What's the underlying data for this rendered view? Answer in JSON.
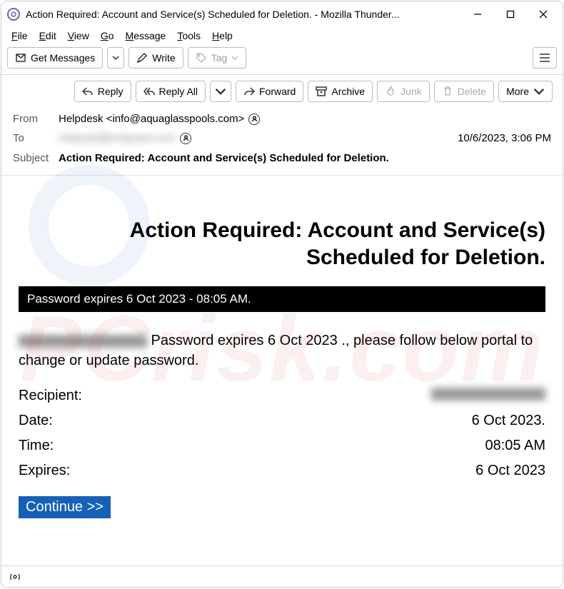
{
  "window": {
    "title": "Action Required: Account and Service(s) Scheduled for Deletion. - Mozilla Thunder..."
  },
  "menubar": {
    "file": "File",
    "edit": "Edit",
    "view": "View",
    "go": "Go",
    "message": "Message",
    "tools": "Tools",
    "help": "Help"
  },
  "toolbar": {
    "get_messages": "Get Messages",
    "write": "Write",
    "tag": "Tag"
  },
  "actions": {
    "reply": "Reply",
    "reply_all": "Reply All",
    "forward": "Forward",
    "archive": "Archive",
    "junk": "Junk",
    "delete": "Delete",
    "more": "More"
  },
  "headers": {
    "from_label": "From",
    "from_value": "Helpdesk <info@aquaglasspools.com>",
    "to_label": "To",
    "to_value": "redacted@redacted.com",
    "datetime": "10/6/2023, 3:06 PM",
    "subject_label": "Subject",
    "subject_value": "Action Required: Account and Service(s) Scheduled for Deletion."
  },
  "email": {
    "title": "Action Required: Account and Service(s) Scheduled for Deletion.",
    "blackbar": "Password expires  6 Oct 2023 - 08:05 AM.",
    "para_part2": " Password expires 6 Oct 2023 ., please follow below portal to change or update password.",
    "recipient_label": "Recipient:",
    "recipient_value": "redacted@redacted.com",
    "date_label": "Date:",
    "date_value": "6 Oct 2023.",
    "time_label": "Time:",
    "time_value": "08:05 AM",
    "expires_label": "Expires:",
    "expires_value": "6 Oct 2023",
    "continue": "Continue >>"
  },
  "watermark": "PCrisk.com"
}
